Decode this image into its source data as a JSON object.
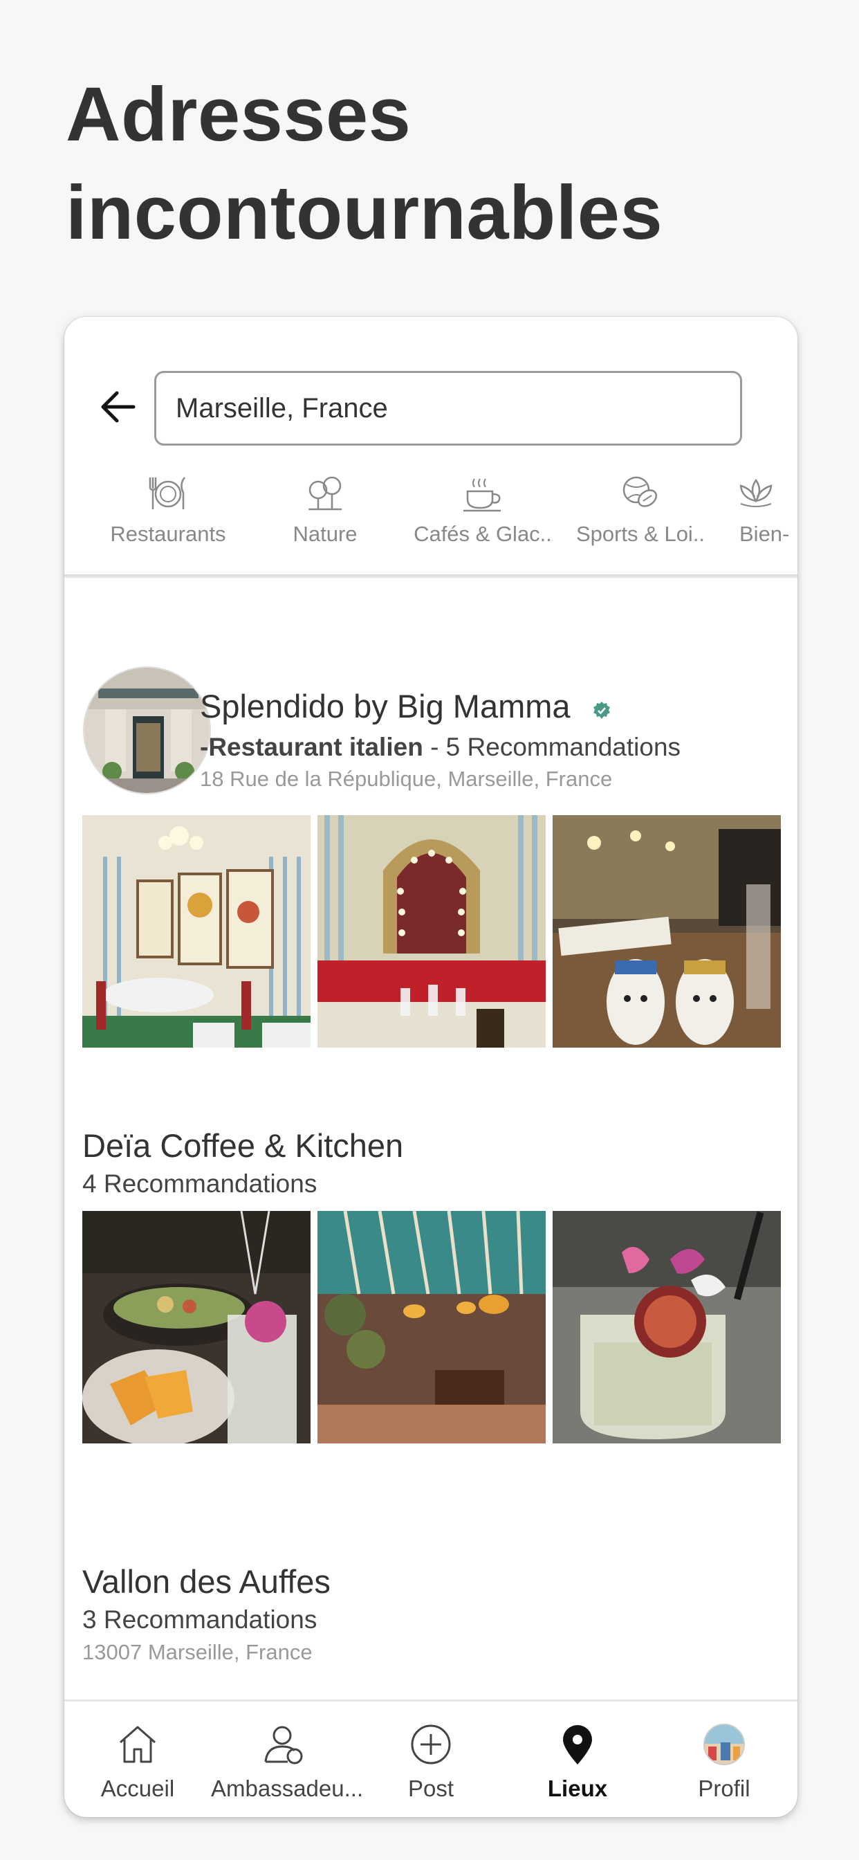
{
  "headline": {
    "line1": "Adresses",
    "line2": "incontournables"
  },
  "search": {
    "value": "Marseille, France"
  },
  "categories": [
    {
      "label": "Restaurants",
      "icon": "cutlery-plate-icon"
    },
    {
      "label": "Nature",
      "icon": "trees-icon"
    },
    {
      "label": "Cafés & Glac..",
      "icon": "coffee-cup-icon"
    },
    {
      "label": "Sports & Loi..",
      "icon": "sports-balls-icon"
    },
    {
      "label": "Bien-",
      "icon": "lotus-icon"
    }
  ],
  "places": [
    {
      "name": "Splendido by Big Mamma",
      "verified": true,
      "category": "-Restaurant italien",
      "recommendations": " - 5 Recommandations",
      "address": "18 Rue de la République, Marseille, France"
    },
    {
      "name": "Deïa Coffee & Kitchen",
      "recommendations": "4 Recommandations"
    },
    {
      "name": "Vallon des Auffes",
      "recommendations": "3 Recommandations",
      "address": "13007 Marseille, France"
    }
  ],
  "nav": [
    {
      "label": "Accueil",
      "icon": "home-icon"
    },
    {
      "label": "Ambassadeu...",
      "icon": "ambassador-person-icon"
    },
    {
      "label": "Post",
      "icon": "plus-circle-icon"
    },
    {
      "label": "Lieux",
      "icon": "map-pin-icon",
      "active": true
    },
    {
      "label": "Profil",
      "icon": "profile-avatar-icon"
    }
  ],
  "colors": {
    "verified": "#4a9a8a",
    "active_nav": "#111111",
    "muted_text": "#999999"
  }
}
